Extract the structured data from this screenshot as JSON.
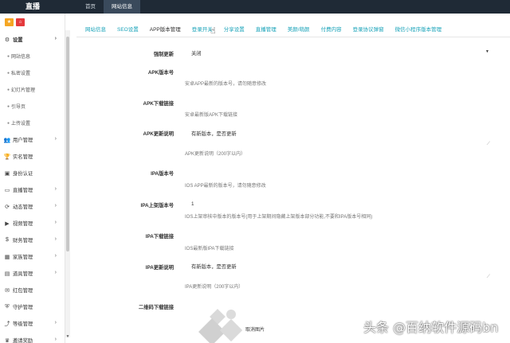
{
  "topbar": {
    "brand": "直播",
    "nav": [
      {
        "label": "首页",
        "active": false
      },
      {
        "label": "网站信息",
        "active": true
      }
    ]
  },
  "sidebar": {
    "quick_buttons": [
      {
        "icon": "star-icon",
        "glyph": "★",
        "color": "#f5a623"
      },
      {
        "icon": "home-icon",
        "glyph": "⌂",
        "color": "#e4393c"
      }
    ],
    "menu": [
      {
        "label": "设置",
        "icon": "gears-icon",
        "glyph": "⚙",
        "open": true,
        "chevron": "›"
      },
      {
        "label": "网站信息",
        "sub": true
      },
      {
        "label": "私密设置",
        "sub": true
      },
      {
        "label": "幻灯片管理",
        "sub": true
      },
      {
        "label": "引导页",
        "sub": true
      },
      {
        "label": "上传设置",
        "sub": true
      },
      {
        "label": "用户管理",
        "icon": "users-icon",
        "glyph": "👥",
        "chevron": "›"
      },
      {
        "label": "实名管理",
        "icon": "trophy-icon",
        "glyph": "🏆"
      },
      {
        "label": "身份认证",
        "icon": "id-card-icon",
        "glyph": "▣"
      },
      {
        "label": "直播管理",
        "icon": "monitor-icon",
        "glyph": "▭",
        "chevron": "›"
      },
      {
        "label": "动态管理",
        "icon": "sync-icon",
        "glyph": "⟳",
        "chevron": "›"
      },
      {
        "label": "视频管理",
        "icon": "video-icon",
        "glyph": "▶",
        "chevron": "›"
      },
      {
        "label": "财务管理",
        "icon": "dollar-icon",
        "glyph": "$",
        "chevron": "›"
      },
      {
        "label": "家族管理",
        "icon": "family-icon",
        "glyph": "▦",
        "chevron": "›"
      },
      {
        "label": "道具管理",
        "icon": "tools-icon",
        "glyph": "▤",
        "chevron": "›"
      },
      {
        "label": "红包管理",
        "icon": "envelope-icon",
        "glyph": "✉"
      },
      {
        "label": "守护管理",
        "icon": "shield-icon",
        "glyph": "⛨"
      },
      {
        "label": "等级管理",
        "icon": "level-icon",
        "glyph": "⤴",
        "chevron": "›"
      },
      {
        "label": "邀请奖励",
        "icon": "gift-icon",
        "glyph": "♛",
        "chevron": "›"
      }
    ]
  },
  "tabs": [
    {
      "label": "网站信息",
      "active": false
    },
    {
      "label": "SEO设置",
      "active": false
    },
    {
      "label": "APP版本管理",
      "active": true
    },
    {
      "label": "登录开关",
      "active": false
    },
    {
      "label": "分享设置",
      "active": false
    },
    {
      "label": "直播管理",
      "active": false
    },
    {
      "label": "美颜/萌颜",
      "active": false
    },
    {
      "label": "付费内容",
      "active": false
    },
    {
      "label": "登录协议弹窗",
      "active": false
    },
    {
      "label": "微信小程序版本管理",
      "active": false
    }
  ],
  "form": {
    "force_update": {
      "label": "强制更新",
      "value": "关闭"
    },
    "apk_version": {
      "label": "APK版本号",
      "value": "",
      "help": "安卓APP最新的版本号，请勿随意修改"
    },
    "apk_download": {
      "label": "APK下载链接",
      "value": "",
      "help": "安卓最新版APK下载链接"
    },
    "apk_desc": {
      "label": "APK更新说明",
      "value": "有新版本，是否更新",
      "help": "APK更新说明（200字以内）"
    },
    "ipa_version": {
      "label": "IPA版本号",
      "value": "",
      "help": "IOS APP最新的版本号，请勿随意修改"
    },
    "ipa_shelf_version": {
      "label": "IPA上架版本号",
      "value": "1",
      "help": "IOS上架审核中版本的版本号(用于上架期间隐藏上架版本部分功能,不要和IPA版本号相同)"
    },
    "ipa_download": {
      "label": "IPA下载链接",
      "value": "",
      "help": "IOS最新版IPA下载链接"
    },
    "ipa_desc": {
      "label": "IPA更新说明",
      "value": "有新版本，是否更新",
      "help": "IPA更新说明（200字以内）"
    },
    "qrcode": {
      "label": "二维码下载链接",
      "cancel_label": "取消图片"
    }
  },
  "watermark": "头条 @百纳软件源码bn"
}
